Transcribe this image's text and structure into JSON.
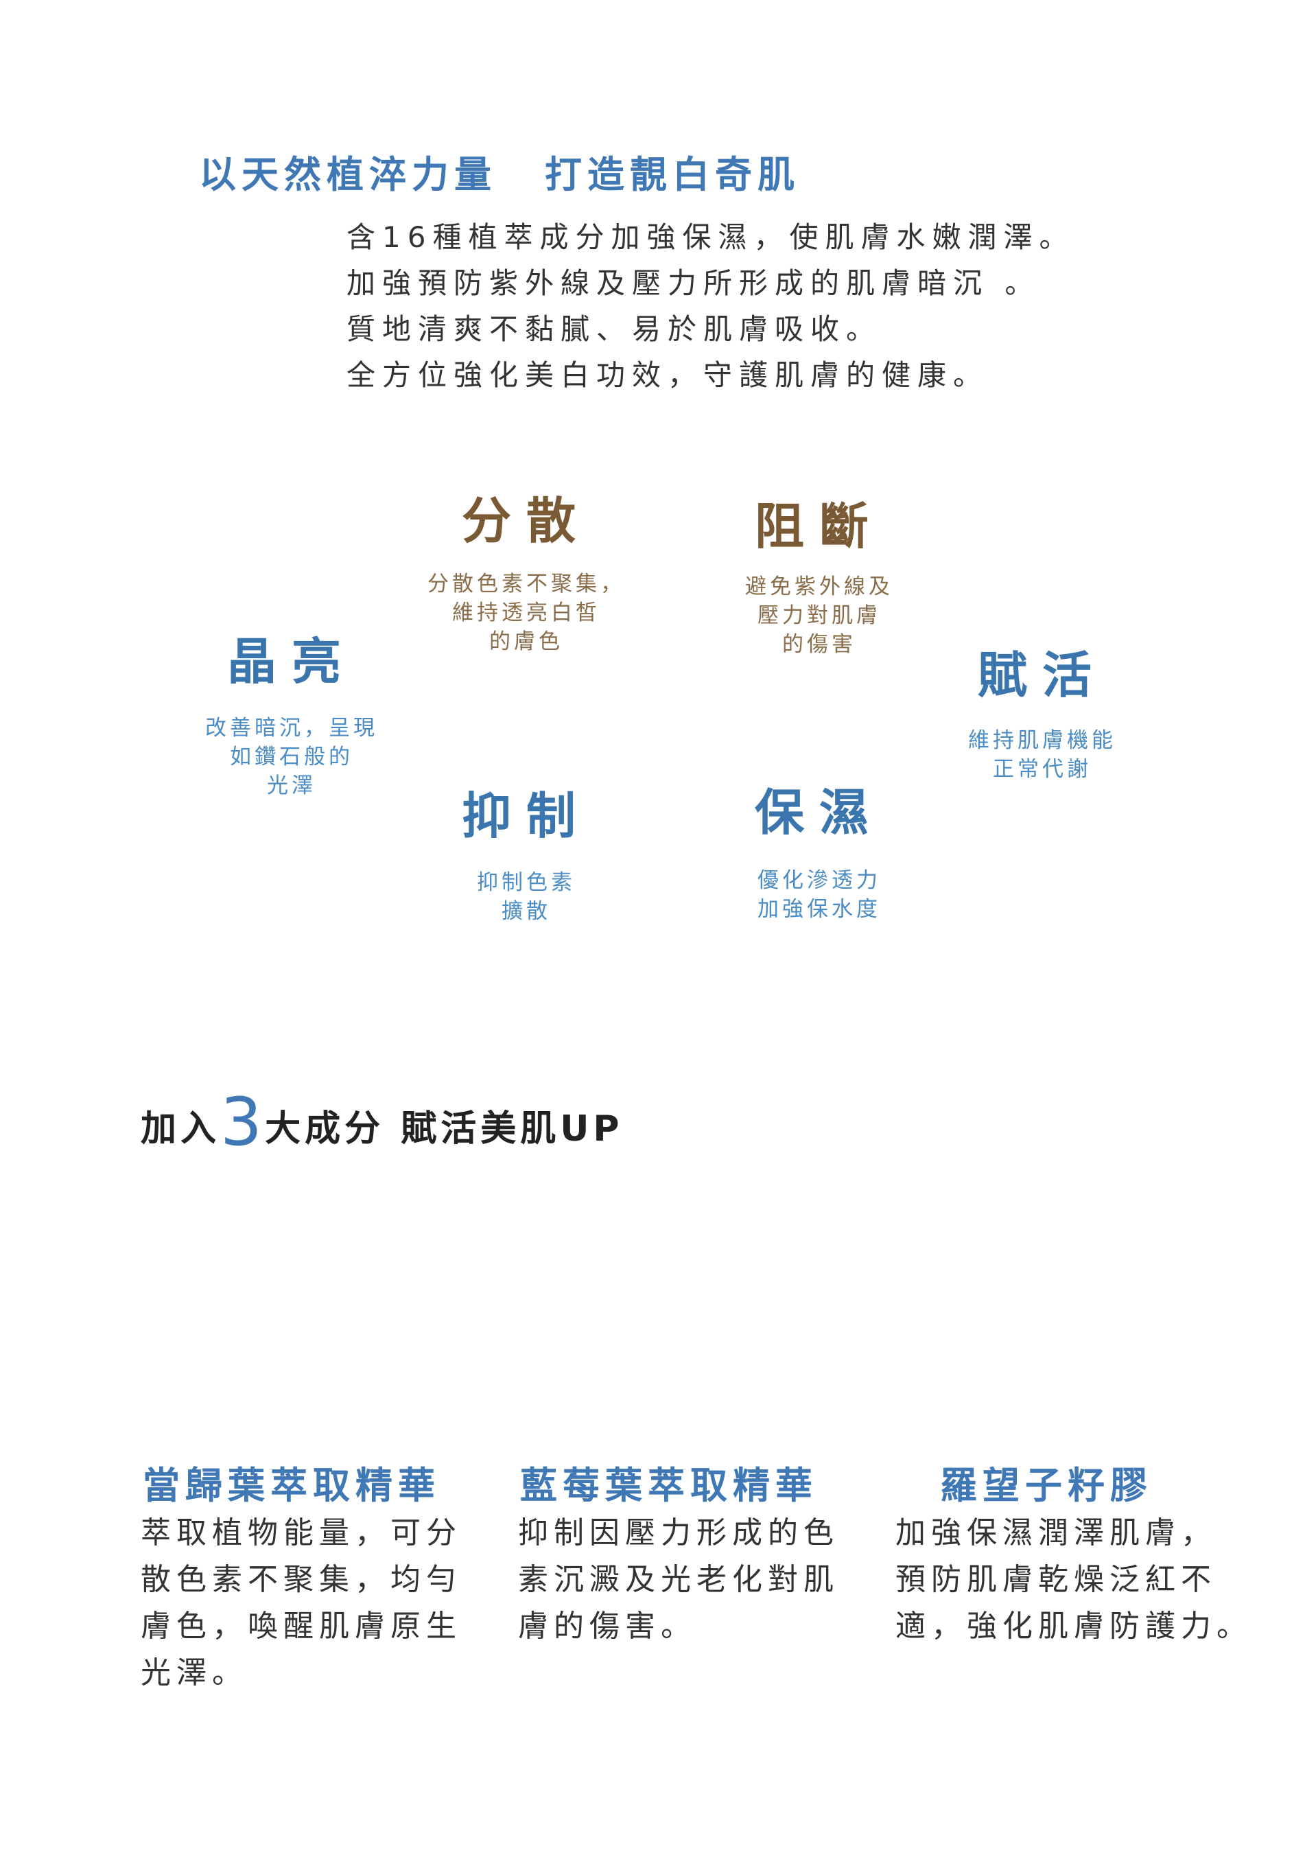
{
  "headline": {
    "part1": "以天然植淬力量",
    "part2": "打造靚白奇肌"
  },
  "intro": {
    "lines": [
      "含16種植萃成分加強保濕，使肌膚水嫩潤澤。",
      "加強預防紫外線及壓力所形成的肌膚暗沉 。",
      "質地清爽不黏膩、易於肌膚吸收。",
      "全方位強化美白功效，守護肌膚的健康。"
    ]
  },
  "benefits": [
    {
      "title": "分散",
      "desc": [
        "分散色素不聚集，",
        "維持透亮白皙",
        "的膚色"
      ],
      "color": "#7a5a34"
    },
    {
      "title": "阻斷",
      "desc": [
        "避免紫外線及",
        "壓力對肌膚",
        "的傷害"
      ],
      "color": "#7a5a34"
    },
    {
      "title": "晶亮",
      "desc": [
        "改善暗沉，呈現",
        "如鑽石般的",
        "光澤"
      ],
      "color": "#3a76ad"
    },
    {
      "title": "賦活",
      "desc": [
        "維持肌膚機能",
        "正常代謝"
      ],
      "color": "#3a76ad"
    },
    {
      "title": "抑制",
      "desc": [
        "抑制色素",
        "擴散"
      ],
      "color": "#3a76ad"
    },
    {
      "title": "保濕",
      "desc": [
        "優化滲透力",
        "加強保水度"
      ],
      "color": "#3a76ad"
    }
  ],
  "section": {
    "prefix": "加入",
    "number": "3",
    "suffix": "大成分 賦活美肌UP"
  },
  "ingredients": [
    {
      "name": "當歸葉萃取精華",
      "desc": [
        "萃取植物能量，可分",
        "散色素不聚集，均勻",
        "膚色，喚醒肌膚原生",
        "光澤。"
      ]
    },
    {
      "name": "藍莓葉萃取精華",
      "desc": [
        "抑制因壓力形成的色",
        "素沉澱及光老化對肌",
        "膚的傷害。"
      ]
    },
    {
      "name": "羅望子籽膠",
      "desc": [
        "加強保濕潤澤肌膚，",
        "預防肌膚乾燥泛紅不",
        "適，強化肌膚防護力。"
      ]
    }
  ]
}
